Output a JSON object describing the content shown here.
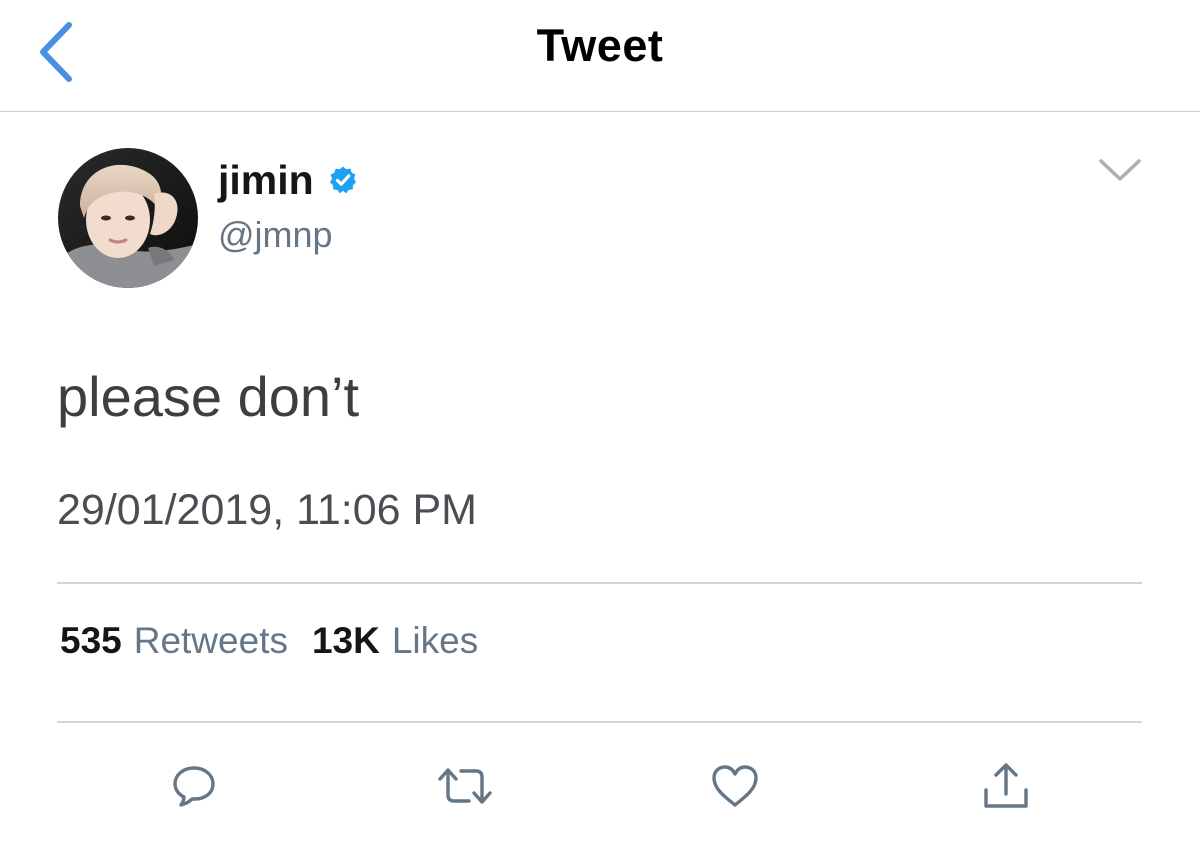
{
  "header": {
    "title": "Tweet",
    "back_icon": "chevron-left-icon"
  },
  "author": {
    "display_name": "jimin",
    "verified": true,
    "handle": "@jmnp"
  },
  "tweet": {
    "text": "please don’t",
    "timestamp": "29/01/2019, 11:06 PM"
  },
  "stats": {
    "retweets_count": "535",
    "retweets_label": "Retweets",
    "likes_count": "13K",
    "likes_label": "Likes"
  },
  "actions": [
    "reply-icon",
    "retweet-icon",
    "like-icon",
    "share-icon"
  ],
  "colors": {
    "accent": "#4a90e2",
    "verified": "#1da1f2",
    "secondary_text": "#657786",
    "icon": "#657786"
  }
}
